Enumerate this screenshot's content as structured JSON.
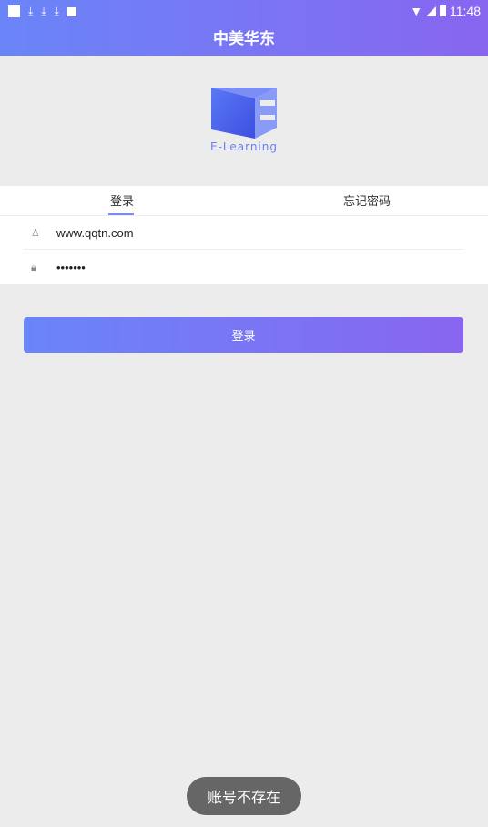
{
  "status_bar": {
    "time": "11:48"
  },
  "header": {
    "title": "中美华东"
  },
  "logo": {
    "text": "E-Learning"
  },
  "tabs": [
    {
      "label": "登录",
      "active": true
    },
    {
      "label": "忘记密码",
      "active": false
    }
  ],
  "form": {
    "username": "www.qqtn.com",
    "password": "•••••••"
  },
  "login_button": "登录",
  "toast": "账号不存在",
  "colors": {
    "accent_start": "#6a85f8",
    "accent_end": "#8866f0"
  }
}
